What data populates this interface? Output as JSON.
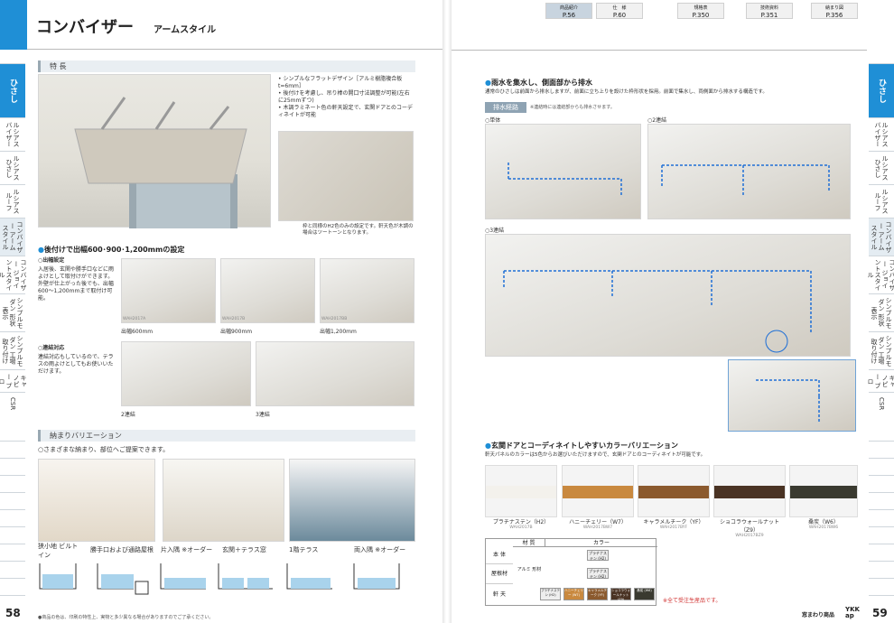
{
  "header": {
    "title": "コンバイザー",
    "subtitle": "アームスタイル"
  },
  "top_tabs": [
    {
      "label": "商品紹介",
      "page": "P.56"
    },
    {
      "label": "仕　様",
      "page": "P.60"
    },
    {
      "label": "規格表",
      "page": "P.350"
    },
    {
      "label": "技術資料",
      "page": "P.351"
    },
    {
      "label": "納まり図",
      "page": "P.356"
    }
  ],
  "side_tabs_left": [
    "ひさし",
    "ルシアス バイザー",
    "ルシアス ひさし",
    "ルシアス ルーフ",
    "コンバイザー アームスタイル",
    "コンバイザー ジョイントスタイル",
    "シンプルモダン 形状表示",
    "シンプルモダン 工場取り付け",
    "キャノピー プロ",
    "CSR"
  ],
  "side_tabs_right": [
    "ひさし",
    "ルシアス バイザー",
    "ルシアス ひさし",
    "ルシアス ルーフ",
    "コンバイザー アームスタイル",
    "コンバイザー ジョイントスタイル",
    "シンプルモダン 形状表示",
    "シンプルモダン 工場取り付け",
    "キャノピー プロ",
    "CSR"
  ],
  "features": {
    "label": "特 長",
    "bullets": [
      "シンプルなフラットデザイン［アルミ樹脂複合板t=6mm］",
      "後付けを考慮し、吊り棒の開口寸法調整が可能(左右に25mmずつ)",
      "木調ラミネート色の軒天設定で、玄関ドアとのコーディネイトが可能"
    ],
    "note": "枠と同様のH2色のみの設定です。軒天色が木調の場合はツートーンとなります。"
  },
  "widths": {
    "heading": "後付けで出幅600･900･1,200mmの設定",
    "sub1": "出幅設定",
    "text1": "入居後、玄関や勝手口などに雨よけとして取付けができます。外壁が仕上がった後でも、出幅600〜1,200mmまで取付け可能。",
    "items": [
      {
        "code": "WAH2017A",
        "label": "出幅600mm"
      },
      {
        "code": "WAH2017B",
        "label": "出幅900mm"
      },
      {
        "code": "WAH2017BB",
        "label": "出幅1,200mm"
      }
    ],
    "sub2": "連結対応",
    "text2": "連結対応もしているので、テラスの雨よけとしてもお使いいただけます。",
    "links": [
      "2連結",
      "3連結"
    ]
  },
  "variation": {
    "label": "納まりバリエーション",
    "heading": "さまざまな納まり、部位へご提案できます。",
    "items": [
      "狭小地 ビルトイン",
      "勝手口および通路屋根",
      "片入隅 ※オーダー",
      "玄関＋テラス窓",
      "1階テラス",
      "両入隅 ※オーダー"
    ]
  },
  "drain": {
    "heading": "雨水を集水し、側面部から排水",
    "text": "通常のひさしは前面から排水しますが、前面に立ち上りを設けた枠形状を採用。前面で集水し、両側面から排水する構造です。",
    "label": "排水経路",
    "note": "※連結時には連結部からも排水させます。",
    "items": [
      "単体",
      "2連結",
      "3連結"
    ]
  },
  "colors": {
    "heading": "玄関ドアとコーディネイトしやすいカラーバリエーション",
    "text": "軒天パネルのカラーは5色からお選びいただけますので、玄関ドアとのコーディネイトが可能です。",
    "items": [
      {
        "name": "プラチナステン（H2）",
        "code": "WAH2017B",
        "color": "#f3f1ec"
      },
      {
        "name": "ハニーチェリー（W7）",
        "code": "WAH2017BW7",
        "color": "#c9893f"
      },
      {
        "name": "キャラメルチーク（YF）",
        "code": "WAH2017BYF",
        "color": "#8b5a2e"
      },
      {
        "name": "ショコラウォールナット（Z9）",
        "code": "WAH2017BZ9",
        "color": "#4a3324"
      },
      {
        "name": "桑炭（W6）",
        "code": "WAH2017BW6",
        "color": "#3a3a30"
      }
    ]
  },
  "table": {
    "col1": "材 質",
    "col2": "カラー",
    "rows": [
      {
        "label": "本 体",
        "value": "プラチナステン (H2)"
      },
      {
        "label": "屋根材",
        "mat": "アルミ 形材",
        "value": "プラチナステン (H2)"
      },
      {
        "label": "軒 天",
        "values": [
          "プラチナステン (H2)",
          "ハニーチェリー (W7)",
          "キャラメルチーク (YF)",
          "ショコラウォールナット (Z9)",
          "桑炭 (W6)"
        ]
      }
    ],
    "note": "※全て受注生産品です。"
  },
  "footer": {
    "left_page": "58",
    "right_page": "59",
    "note": "●商品の色は、印刷の特性上、実物と多少異なる場合がありますのでご了承ください。",
    "brand": "窓まわり商品",
    "logo": "YKK ap"
  }
}
